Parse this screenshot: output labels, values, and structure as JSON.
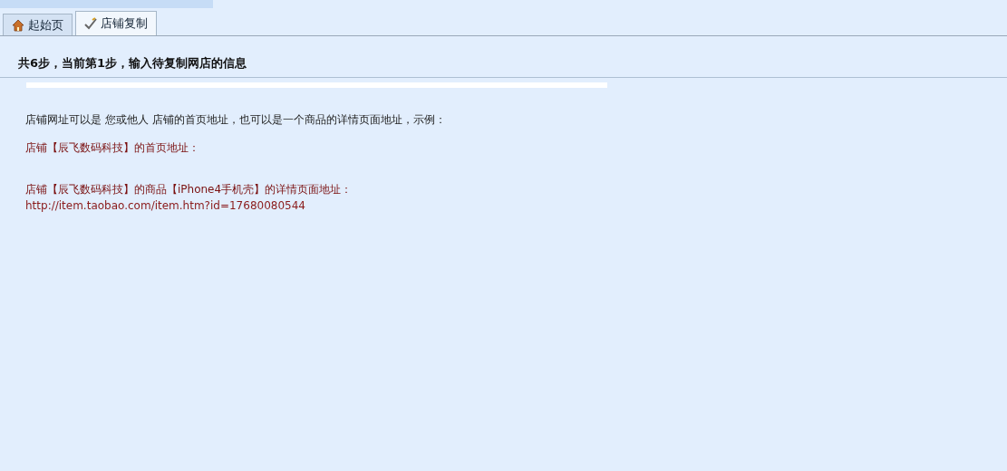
{
  "tabs": [
    {
      "label": "起始页",
      "kind": "home",
      "selected": false
    },
    {
      "label": "店铺复制",
      "kind": "copy",
      "selected": true
    }
  ],
  "step_title": "共6步，当前第1步，输入待复制网店的信息",
  "intro": "店铺网址可以是 您或他人 店铺的首页地址，也可以是一个商品的详情页面地址，示例：",
  "examples": [
    {
      "label": "店铺【辰飞数码科技】的首页地址："
    },
    {
      "label": "店铺【辰飞数码科技】的商品【iPhone4手机壳】的详情页面地址：",
      "url": "http://item.taobao.com/item.htm?id=17680080544"
    }
  ]
}
